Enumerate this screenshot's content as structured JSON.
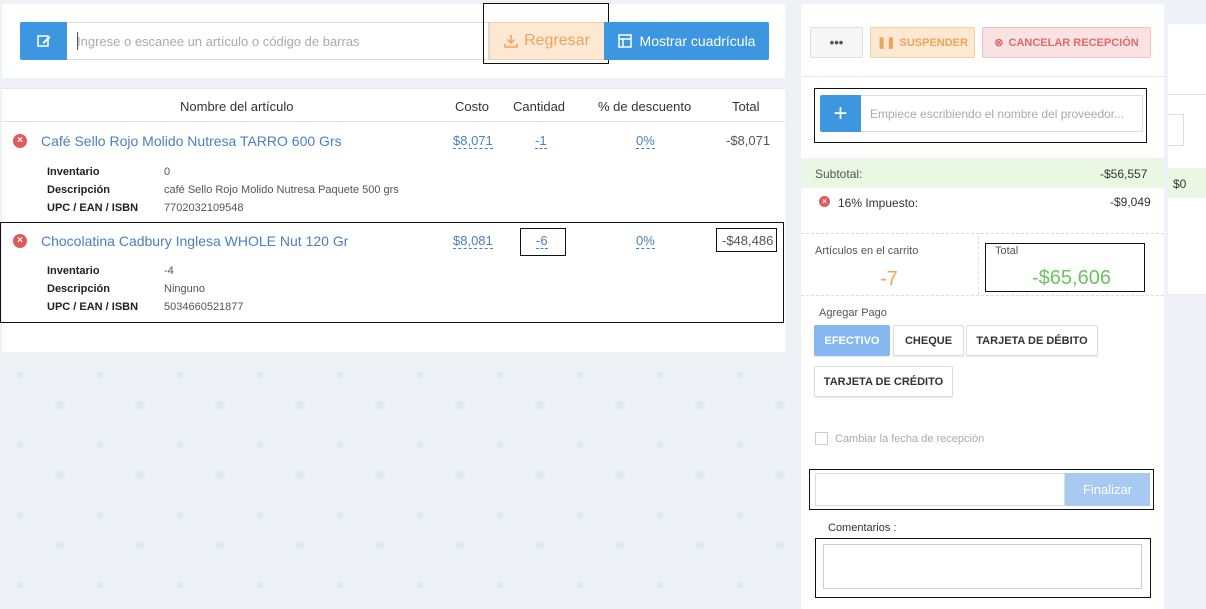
{
  "toolbar": {
    "search_placeholder": "Ingrese o escanee un artículo o código de barras",
    "regresar_label": "Regresar",
    "grid_label": "Mostrar cuadrícula"
  },
  "table": {
    "headers": [
      "Nombre del artículo",
      "Costo",
      "Cantidad",
      "% de descuento",
      "Total"
    ],
    "items": [
      {
        "name": "Café Sello Rojo Molido Nutresa TARRO 600 Grs",
        "cost": "$8,071",
        "qty": "-1",
        "discount": "0%",
        "total": "-$8,071",
        "details": [
          {
            "label": "Inventario",
            "value": "0"
          },
          {
            "label": "Descripción",
            "value": "café Sello Rojo Molido Nutresa Paquete 500 grs"
          },
          {
            "label": "UPC / EAN / ISBN",
            "value": "7702032109548"
          }
        ]
      },
      {
        "name": "Chocolatina Cadbury Inglesa WHOLE Nut 120 Gr",
        "cost": "$8,081",
        "qty": "-6",
        "discount": "0%",
        "total": "-$48,486",
        "details": [
          {
            "label": "Inventario",
            "value": "-4"
          },
          {
            "label": "Descripción",
            "value": "Ninguno"
          },
          {
            "label": "UPC / EAN / ISBN",
            "value": "5034660521877"
          }
        ]
      }
    ]
  },
  "right": {
    "more_label": "•••",
    "suspend_label": "SUSPENDER",
    "cancel_label": "CANCELAR RECEPCIÓN",
    "supplier_placeholder": "Empiece escribiendo el nombre del proveedor...",
    "subtotal_label": "Subtotal:",
    "subtotal_value": "-$56,557",
    "tax_label": "16% Impuesto:",
    "tax_value": "-$9,049",
    "cart_label": "Artículos en el carrito",
    "cart_count": "-7",
    "total_label": "Total",
    "total_value": "-$65,606",
    "payment_title": "Agregar Pago",
    "payments": [
      "EFECTIVO",
      "CHEQUE",
      "TARJETA DE DÉBITO",
      "TARJETA DE CRÉDITO"
    ],
    "change_date_label": "Cambiar la fecha de recepción",
    "finalize_label": "Finalizar",
    "comments_label": "Comentarios :"
  },
  "far_right": {
    "value": "$0"
  },
  "colors": {
    "primary": "#3d96e0",
    "warning": "#f0a35a",
    "danger": "#e06b6b",
    "success": "#6cc461",
    "link": "#4a7fc1"
  }
}
